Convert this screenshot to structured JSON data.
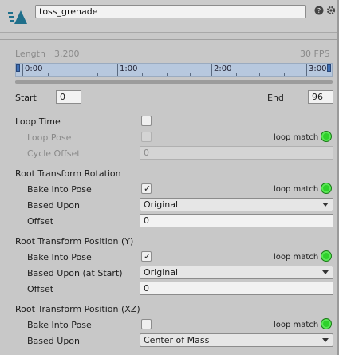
{
  "header": {
    "clip_name": "toss_grenade"
  },
  "info": {
    "length_label": "Length",
    "length_value": "3.200",
    "fps": "30 FPS"
  },
  "timeline": {
    "labels": [
      "0:00",
      "1:00",
      "2:00",
      "3:00"
    ]
  },
  "range": {
    "start_label": "Start",
    "start_value": "0",
    "end_label": "End",
    "end_value": "96"
  },
  "loop": {
    "loop_time_label": "Loop Time",
    "loop_time_checked": false,
    "loop_pose_label": "Loop Pose",
    "loop_match_label": "loop match",
    "cycle_offset_label": "Cycle Offset",
    "cycle_offset_value": "0"
  },
  "rotation": {
    "title": "Root Transform Rotation",
    "bake_label": "Bake Into Pose",
    "bake_checked": true,
    "match_label": "loop match",
    "based_label": "Based Upon",
    "based_value": "Original",
    "offset_label": "Offset",
    "offset_value": "0"
  },
  "position_y": {
    "title": "Root Transform Position (Y)",
    "bake_label": "Bake Into Pose",
    "bake_checked": true,
    "match_label": "loop match",
    "based_label": "Based Upon (at Start)",
    "based_value": "Original",
    "offset_label": "Offset",
    "offset_value": "0"
  },
  "position_xz": {
    "title": "Root Transform Position (XZ)",
    "bake_label": "Bake Into Pose",
    "bake_checked": false,
    "match_label": "loop match",
    "based_label": "Based Upon",
    "based_value": "Center of Mass"
  },
  "icons": {
    "clip": "animation-clip-icon",
    "help": "help-icon",
    "settings": "gear-icon",
    "match_status": "status-green-led"
  },
  "colors": {
    "led": "#2ed12a",
    "timeline_bg": "#b7c8de",
    "clip_icon": "#1f6f8b"
  }
}
